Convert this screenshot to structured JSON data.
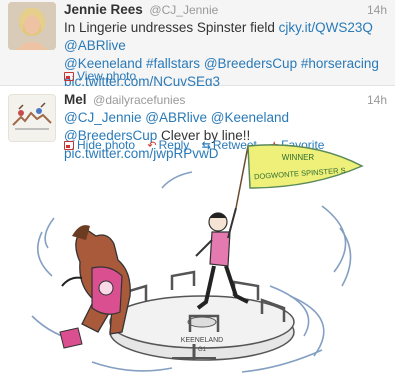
{
  "tweets": [
    {
      "display_name": "Jennie Rees",
      "screen_name": "@CJ_Jennie",
      "time": "14h",
      "text_plain": "In Lingerie undresses Spinster field ",
      "text_link_1": "cjky.it/QWS23Q",
      "text_link_2": "@ABRlive",
      "text_link_3": "@Keeneland",
      "text_link_4": "#fallstars",
      "text_link_5": "@BreedersCup",
      "text_link_6": "#horseracing",
      "text_link_7": "pic.twitter.com/NCuvSEg3",
      "photo_action": "View photo"
    },
    {
      "display_name": "Mel",
      "screen_name": "@dailyracefunies",
      "time": "14h",
      "text_link_1": "@CJ_Jennie",
      "text_link_2": "@ABRlive",
      "text_link_3": "@Keeneland",
      "text_link_4": "@BreedersCup",
      "text_plain": " Clever by line!!",
      "text_link_5": "pic.twitter.com/jwpRPvwD",
      "actions": {
        "hide_photo": "Hide photo",
        "reply": "Reply",
        "retweet": "Retweet",
        "favorite": "Favorite"
      },
      "cartoon": {
        "flag_line_1": "WINNER",
        "flag_line_2": "DOGWONTE SPINSTER S",
        "base_text": "KEENELAND",
        "base_sub": "G1"
      }
    }
  ],
  "colors": {
    "link": "#2a7ab8",
    "action_icon": "#cc3333",
    "muted": "#999999"
  }
}
